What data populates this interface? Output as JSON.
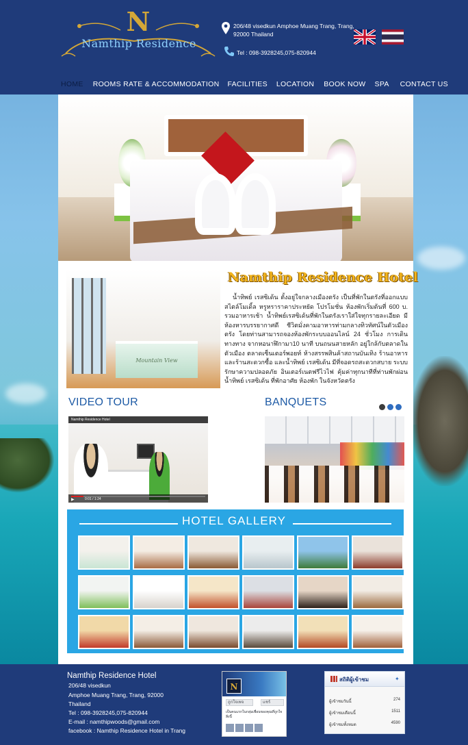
{
  "header": {
    "logo_letter": "N",
    "logo_text": "Namthip Residence",
    "address": "206/48 visedkun Amphoe Muang Trang, Trang, 92000 Thailand",
    "tel": "Tel :  098-3928245,075-820944",
    "languages": [
      "English",
      "Thai"
    ]
  },
  "nav": {
    "items": [
      {
        "label": "HOME",
        "active": true
      },
      {
        "label": "ROOMS RATE & ACCOMMODATION",
        "active": false
      },
      {
        "label": "FACILITIES",
        "active": false
      },
      {
        "label": "LOCATION",
        "active": false
      },
      {
        "label": "BOOK NOW",
        "active": false
      },
      {
        "label": "SPA",
        "active": false
      },
      {
        "label": "CONTACT US",
        "active": false
      }
    ]
  },
  "about": {
    "title": "Namthip Residence Hotel",
    "image_label": "Mountain View",
    "text": "น้ำทิพย์ เรสซิเด้น ตั้งอยู่ใจกลางเมืองตรัง เป็นที่พักในตรังที่ออกแบบสไตล์โมเดิ้ล หรูหราราคาประหยัด โปรโมชั่น ห้องพักเริ่มต้นที่ 600 บ. รวมอาหารเช้า น้ำทิพย์เรสซิเด้นที่พักในตรังเราใส่ใจทุกรายละเอียด มีห้องหารบรรยากาศดี ชีวิตมั่งคามอาหารท่ามกลางทิวทัศน์ในตัวเมืองตรัง โดยท่านสามารถจองห้องพักระบบออนไลน์ 24 ชั่วโมง การเดินทางทาง จากหอนาฬิกามา10 นาที บนถนนสายหลัก อยู่ใกล้กับตลาดในตัวเมือง ตลาดเซ็นเตอร์พอยท์ ห้างสรรพสินค้าสถานบันเทิง ร้านอาหารและร้านสะดวกซื้อ และน้ำทิพย์ เรสซิเด้น มีที่จอดรถสะดวกสบาย ระบบรักษาความปลอดภัย อินเตอร์เนตฟรีไวไฟ คุ้มค่าทุกนาทีที่ท่านพักผ่อน น้ำทิพย์ เรสซิเด้น ที่พักอาศัย ห้องพัก ในจังหวัดตรัง"
  },
  "video": {
    "heading": "VIDEO TOUR",
    "title": "Namthip Residence Hotel",
    "time": "0:01 / 1:24"
  },
  "banquets": {
    "heading": "BANQUETS",
    "slides": 3,
    "active_slide": 2
  },
  "gallery": {
    "title": "HOTEL GALLERY",
    "thumbs": [
      {
        "name": "gallery-lobby-counter",
        "colors": [
          "#f3f1ec",
          "#c9e5d4"
        ]
      },
      {
        "name": "gallery-bedroom-1",
        "colors": [
          "#f4ede4",
          "#a86c44"
        ]
      },
      {
        "name": "gallery-bedroom-2",
        "colors": [
          "#efe8df",
          "#8a5a34"
        ]
      },
      {
        "name": "gallery-hallway",
        "colors": [
          "#e8eef0",
          "#b8c6cc"
        ]
      },
      {
        "name": "gallery-aerial-view",
        "colors": [
          "#8fc4ea",
          "#3e7b3a"
        ]
      },
      {
        "name": "gallery-restaurant",
        "colors": [
          "#eae2da",
          "#8c3c2c"
        ]
      },
      {
        "name": "gallery-reception",
        "colors": [
          "#f2f4f2",
          "#7fbf5a"
        ]
      },
      {
        "name": "gallery-towel-swans",
        "colors": [
          "#ffffff",
          "#d7d2cc"
        ]
      },
      {
        "name": "gallery-food-platter",
        "colors": [
          "#f5e6c8",
          "#c2512a"
        ]
      },
      {
        "name": "gallery-banquet-hall",
        "colors": [
          "#dcdfe4",
          "#a9443a"
        ]
      },
      {
        "name": "gallery-dining-room",
        "colors": [
          "#e6d6c6",
          "#2d2119"
        ]
      },
      {
        "name": "gallery-bedroom-3",
        "colors": [
          "#f2ece4",
          "#9b6a3e"
        ]
      },
      {
        "name": "gallery-dish-salad",
        "colors": [
          "#f1d9a8",
          "#c23a2a"
        ]
      },
      {
        "name": "gallery-bedroom-4",
        "colors": [
          "#f4eee6",
          "#8b5a38"
        ]
      },
      {
        "name": "gallery-bedroom-5",
        "colors": [
          "#efe7de",
          "#7a4a2c"
        ]
      },
      {
        "name": "gallery-sofa-room",
        "colors": [
          "#ececec",
          "#5a4a3a"
        ]
      },
      {
        "name": "gallery-dish-noodles",
        "colors": [
          "#f2e0b8",
          "#b34a24"
        ]
      },
      {
        "name": "gallery-bedroom-6",
        "colors": [
          "#f6f1ea",
          "#a0603a"
        ]
      },
      {
        "name": "gallery-bar-area",
        "colors": [
          "#cfd8e4",
          "#2e2a2a"
        ]
      }
    ]
  },
  "footer": {
    "name": "Namthip Residence Hotel",
    "addr1": "206/48 visedkun",
    "addr2": "Amphoe Muang Trang, Trang, 92000",
    "addr3": "Thailand",
    "tel": "Tel :  098-3928245,075-820944",
    "email": "E-mail :  namthipwoods@gmail.com",
    "facebook": "facebook : Namthip Residence Hotel in Trang",
    "fb_widget": {
      "like": "ถูกใจเพจ",
      "share": "แชร์",
      "text": "เป็นคนแรกในกลุ่มเพื่อนของคุณที่ถูกใจสิ่งนี้"
    },
    "stats": {
      "title": "สถิติผู้เข้าชม",
      "rows": [
        {
          "label": "ผู้เข้าชมวันนี้",
          "value": "274"
        },
        {
          "label": "ผู้เข้าชมเดือนนี้",
          "value": "1511"
        },
        {
          "label": "ผู้เข้าชมทั้งหมด",
          "value": "4590"
        }
      ]
    }
  },
  "colors": {
    "header_bg": "#1f3b7a",
    "accent_gold": "#f2b41d",
    "heading_blue": "#1d5aa5",
    "gallery_bg": "#2aa6e4"
  }
}
